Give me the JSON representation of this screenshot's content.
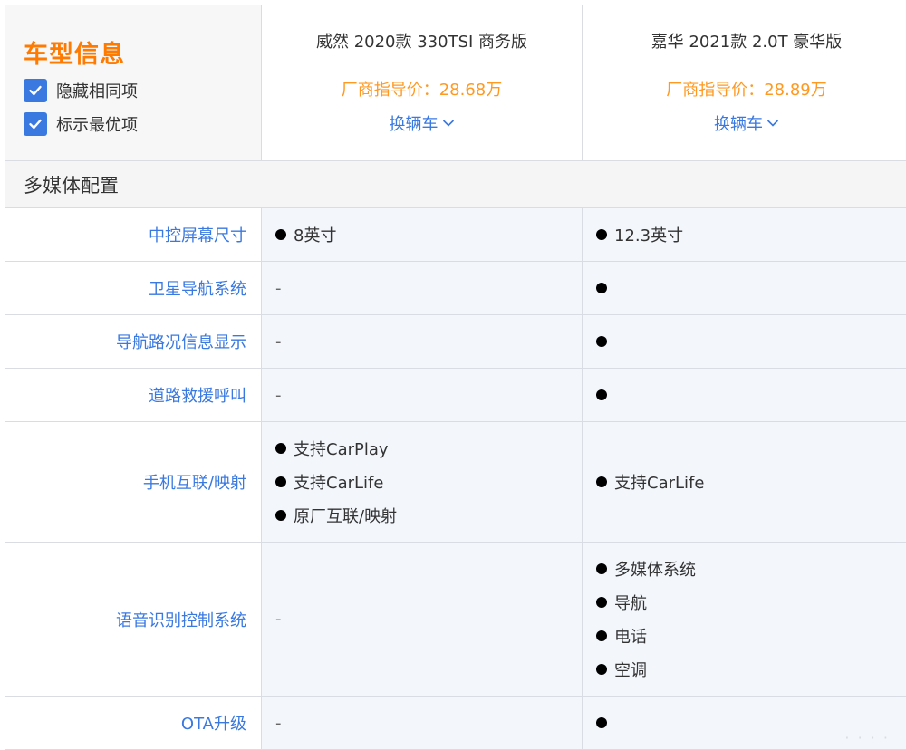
{
  "header": {
    "title": "车型信息",
    "options": [
      {
        "label": "隐藏相同项",
        "checked": true
      },
      {
        "label": "标示最优项",
        "checked": true
      }
    ],
    "cars": [
      {
        "name": "威然 2020款 330TSI 商务版",
        "price": "厂商指导价：28.68万",
        "switch_label": "换辆车"
      },
      {
        "name": "嘉华 2021款 2.0T 豪华版",
        "price": "厂商指导价：28.89万",
        "switch_label": "换辆车"
      }
    ]
  },
  "section": {
    "title": "多媒体配置"
  },
  "rows": [
    {
      "label": "中控屏幕尺寸",
      "car1": [
        "8英寸"
      ],
      "car2": [
        "12.3英寸"
      ]
    },
    {
      "label": "卫星导航系统",
      "car1": "-",
      "car2": [
        ""
      ]
    },
    {
      "label": "导航路况信息显示",
      "car1": "-",
      "car2": [
        ""
      ]
    },
    {
      "label": "道路救援呼叫",
      "car1": "-",
      "car2": [
        ""
      ]
    },
    {
      "label": "手机互联/映射",
      "car1": [
        "支持CarPlay",
        "支持CarLife",
        "原厂互联/映射"
      ],
      "car2": [
        "支持CarLife"
      ]
    },
    {
      "label": "语音识别控制系统",
      "car1": "-",
      "car2": [
        "多媒体系统",
        "导航",
        "电话",
        "空调"
      ]
    },
    {
      "label": "OTA升级",
      "car1": "-",
      "car2": [
        ""
      ]
    }
  ],
  "colors": {
    "accent": "#ff7a00",
    "price": "#ff9922",
    "link": "#3a79e0",
    "value_bg": "#f3f7fc"
  },
  "icons": {
    "checkbox": "checkbox-checked-icon",
    "dropdown": "chevron-down-icon",
    "bullet": "bullet-dot-icon"
  }
}
